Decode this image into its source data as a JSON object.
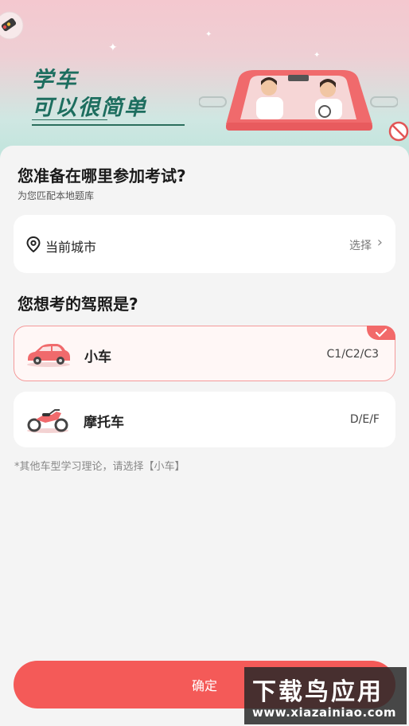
{
  "hero": {
    "line1": "学车",
    "line2": "可以很简单"
  },
  "question1": {
    "title": "您准备在哪里参加考试?",
    "subtitle": "为您匹配本地题库"
  },
  "city": {
    "icon": "location-pin-icon",
    "label": "当前城市",
    "action": "选择",
    "chevron": "›"
  },
  "question2": {
    "title": "您想考的驾照是?"
  },
  "licenses": [
    {
      "name": "小车",
      "codes": "C1/C2/C3",
      "icon": "car-icon",
      "selected": true
    },
    {
      "name": "摩托车",
      "codes": "D/E/F",
      "icon": "motorcycle-icon",
      "selected": false
    }
  ],
  "note": "*其他车型学习理论，请选择【小车】",
  "confirm_label": "确定",
  "watermark": {
    "title": "下载鸟应用",
    "url": "www.xiazainiao.com"
  },
  "colors": {
    "accent": "#f45a58",
    "hero_green": "#1d6e5f"
  }
}
